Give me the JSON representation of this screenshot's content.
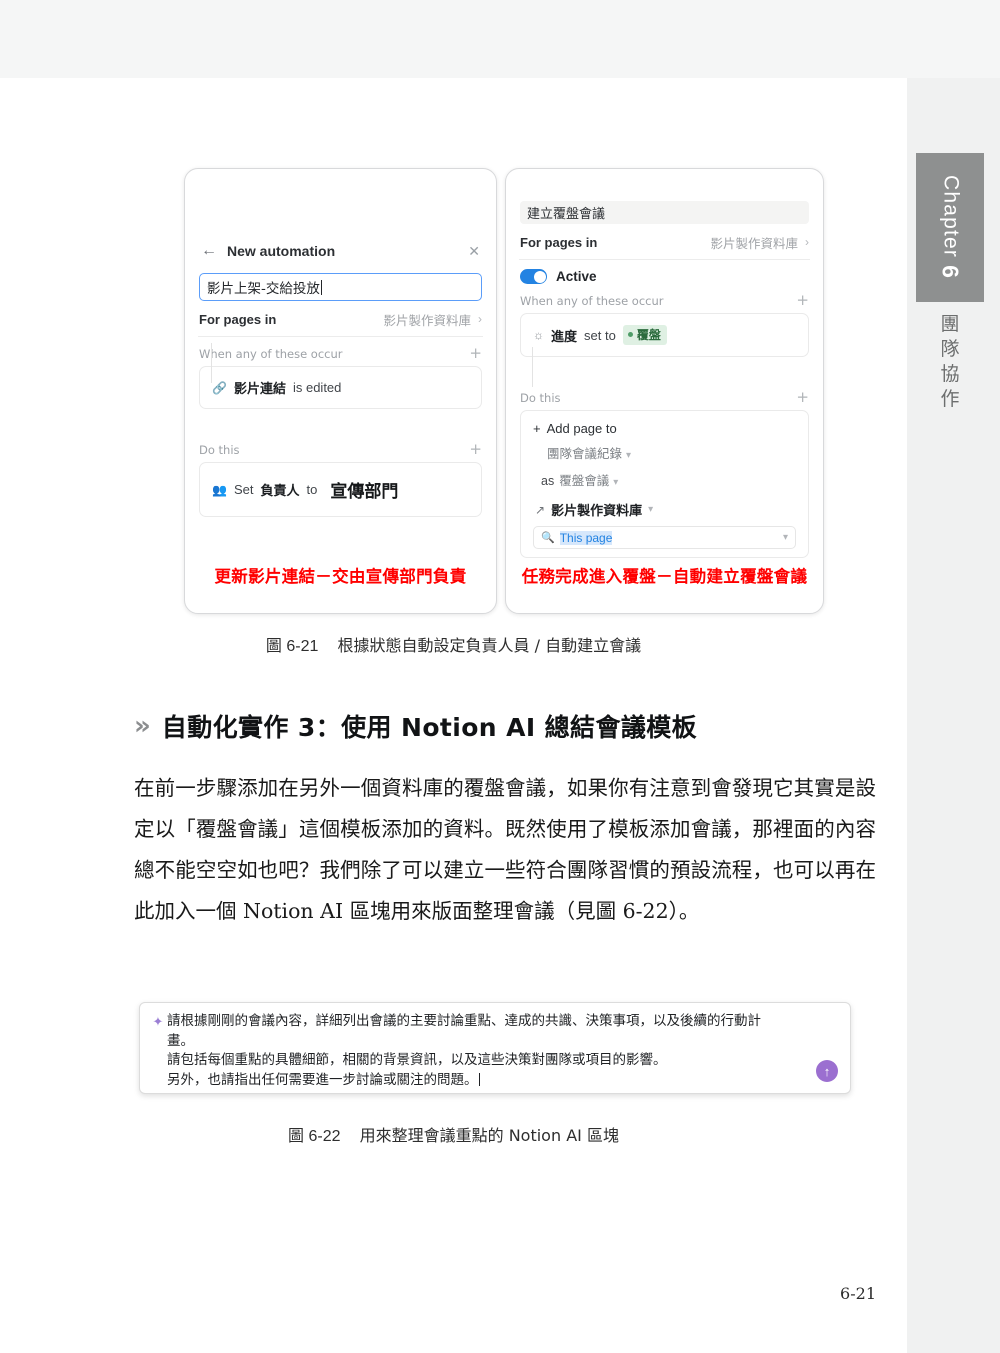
{
  "chapter_tab": {
    "label": "Chapter",
    "number": "6",
    "subtitle_chars": [
      "團",
      "隊",
      "協",
      "作"
    ]
  },
  "figure_6_21": {
    "caption_number": "圖 6-21",
    "caption_text": "根據狀態自動設定負責人員 / 自動建立會議",
    "left_panel": {
      "back_icon": "back-arrow-icon",
      "header_title": "New automation",
      "close_icon": "close-icon",
      "name_value": "影片上架-交給投放",
      "for_pages_label": "For pages in",
      "for_pages_value": "影片製作資料庫",
      "chevron": "›",
      "trigger_section_label": "When any of these occur",
      "trigger_icon": "link-icon",
      "trigger_property": "影片連結",
      "trigger_condition": "is edited",
      "action_section_label": "Do this",
      "action_icon": "people-icon",
      "action_verb": "Set",
      "action_property": "負責人",
      "action_to": "to",
      "action_value": "宣傳部門",
      "plus": "+",
      "red_note": "更新影片連結－交由宣傳部門負責"
    },
    "right_panel": {
      "name_value": "建立覆盤會議",
      "for_pages_label": "For pages in",
      "for_pages_value": "影片製作資料庫",
      "chevron": "›",
      "toggle_label": "Active",
      "toggle_state": "on",
      "trigger_section_label": "When any of these occur",
      "trigger_icon": "status-icon",
      "trigger_property": "進度",
      "trigger_condition": "set to",
      "trigger_value": "覆盤",
      "action_section_label": "Do this",
      "add_page_label": "Add page to",
      "add_page_target": "團隊會議紀錄",
      "as_label": "as",
      "as_value": "覆盤會議",
      "database_icon": "external-link-icon",
      "database_value": "影片製作資料庫",
      "search_icon": "search-icon",
      "search_value": "This page",
      "plus": "+",
      "red_note": "任務完成進入覆盤－自動建立覆盤會議"
    }
  },
  "section_heading": {
    "marker": "»",
    "text": "自動化實作 3：使用 Notion AI 總結會議模板"
  },
  "body_paragraph": "在前一步驟添加在另外一個資料庫的覆盤會議，如果你有注意到會發現它其實是設定以「覆盤會議」這個模板添加的資料。既然使用了模板添加會議，那裡面的內容總不能空空如也吧？我們除了可以建立一些符合團隊習慣的預設流程，也可以再在此加入一個 Notion AI 區塊用來版面整理會議（見圖 6-22）。",
  "figure_6_22": {
    "sparkle_icon": "sparkle-icon",
    "prompt_line_1": "請根據剛剛的會議內容，詳細列出會議的主要討論重點、達成的共識、決策事項，以及後續的行動計",
    "prompt_line_2": "畫。",
    "prompt_line_3": "請包括每個重點的具體細節，相關的背景資訊，以及這些決策對團隊或項目的影響。",
    "prompt_line_4": "另外，也請指出任何需要進一步討論或關注的問題。",
    "send_icon": "send-up-arrow-icon",
    "caption_number": "圖 6-22",
    "caption_text": "用來整理會議重點的 Notion AI 區塊"
  },
  "page_number": "6-21",
  "colors": {
    "accent_blue": "#2383e2",
    "annotation_red": "#ff0000",
    "ai_purple": "#9b6fd0",
    "chapter_tab_gray": "#8e9090",
    "status_green_bg": "#dff0e3"
  }
}
